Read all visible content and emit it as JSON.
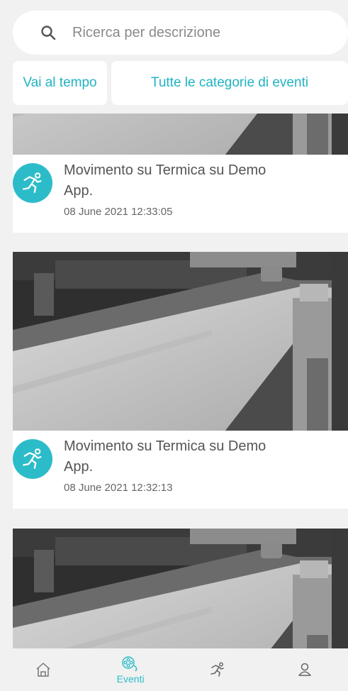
{
  "search": {
    "placeholder": "Ricerca per descrizione"
  },
  "filters": {
    "time_label": "Vai al tempo",
    "category_label": "Tutte le categorie di eventi"
  },
  "events": [
    {
      "title": "Movimento su Termica su Demo App.",
      "timestamp": "08 June 2021 12:33:05",
      "icon": "motion-icon"
    },
    {
      "title": "Movimento su Termica su Demo App.",
      "timestamp": "08 June 2021 12:32:13",
      "icon": "motion-icon"
    },
    {
      "title": "",
      "timestamp": "",
      "icon": "motion-icon"
    }
  ],
  "nav": {
    "items": [
      {
        "name": "home",
        "icon": "home-icon",
        "label": ""
      },
      {
        "name": "events",
        "icon": "film-reel-icon",
        "label": "Eventi",
        "active": true
      },
      {
        "name": "motion",
        "icon": "motion-icon",
        "label": ""
      },
      {
        "name": "account",
        "icon": "user-icon",
        "label": ""
      }
    ]
  },
  "colors": {
    "accent": "#2cbcc9",
    "background": "#f1f1f1"
  }
}
